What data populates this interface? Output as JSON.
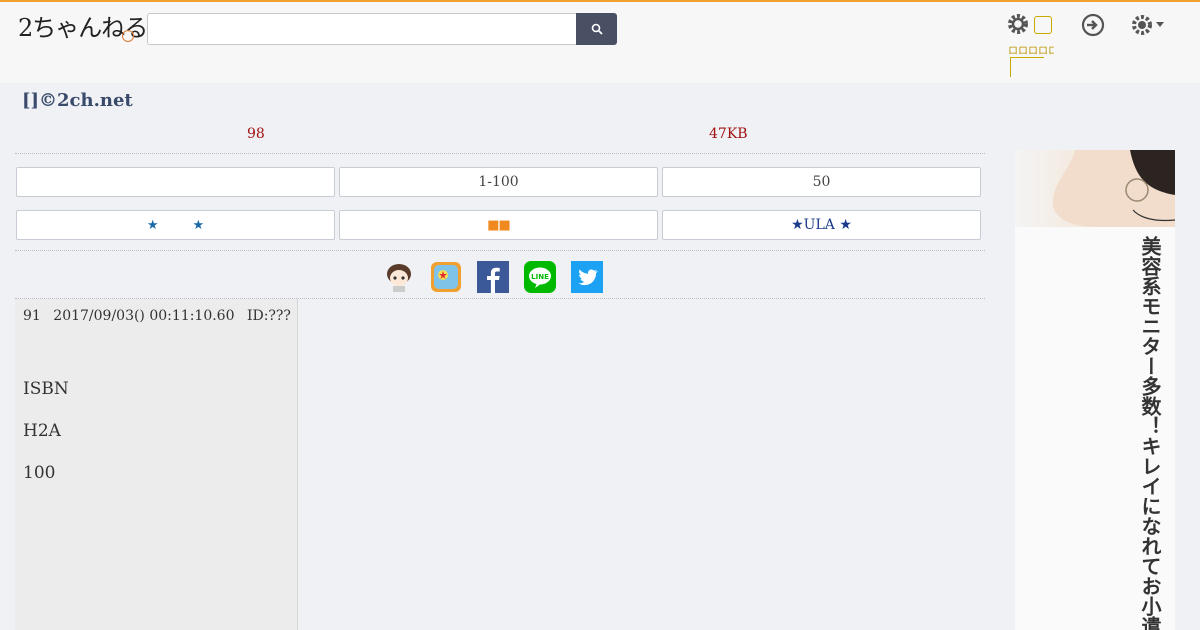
{
  "header": {
    "logo_text": "2ちゃんねる",
    "search": {
      "value": "",
      "placeholder": ""
    },
    "search_button_icon": "search-icon",
    "yellow_label": "ロロロロロロ",
    "icons": [
      "gear-icon",
      "login-icon",
      "settings-icon"
    ]
  },
  "thread": {
    "title": "[]©2ch.net",
    "post_count": "98",
    "size": "47KB"
  },
  "nav": {
    "row1": [
      "",
      "1-100",
      "50"
    ],
    "row2": [
      {
        "prefix": "★",
        "suffix": "★"
      },
      {
        "label": "■■"
      },
      {
        "label": "★ULA ★"
      }
    ]
  },
  "share": [
    "mascot-icon",
    "app-icon",
    "facebook-icon",
    "line-icon",
    "twitter-icon"
  ],
  "post": {
    "number": "91",
    "date": "2017/09/03() 00:11:10.60",
    "id": "ID:???",
    "lines": [
      "ISBN",
      "H2A",
      "100"
    ]
  },
  "ad": {
    "text": "美容系モニター多数！キレイになれてお小遣いまでもらえる♪"
  },
  "colors": {
    "accent_border": "#f0a030",
    "search_button": "#4a5064",
    "count_red": "#a01010",
    "title_blue": "#3a4a6b"
  }
}
